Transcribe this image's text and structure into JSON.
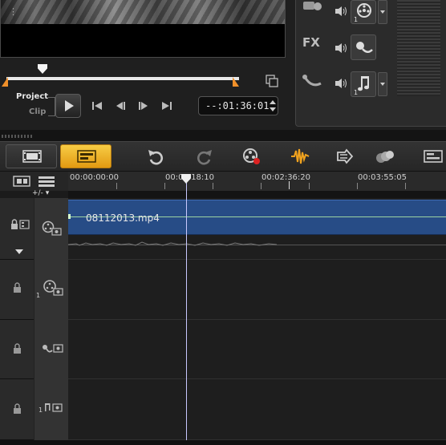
{
  "preview": {
    "timecode": "--:01:36:01"
  },
  "modes": {
    "project": "Project",
    "clip": "Clip"
  },
  "track_tools": {
    "fx_label": "FX",
    "track_numbers": [
      "1",
      "1"
    ]
  },
  "ruler": {
    "labels": [
      "00:00:00:00",
      "00:01:18:10",
      "00:02:36:20",
      "00:03:55:05"
    ],
    "add_remove": "+/-"
  },
  "timeline": {
    "clip_name": "08112013.mp4",
    "overlay_track_number": "1"
  },
  "colors": {
    "accent": "#f0a21e",
    "clip": "#274c86",
    "trim": "#f0902a"
  },
  "icons": {
    "toolbar": [
      "storyboard-view-icon",
      "timeline-view-icon",
      "undo-icon",
      "redo-icon",
      "record-capture-icon",
      "sound-mixer-icon",
      "auto-music-icon",
      "motion-tracking-icon",
      "subtitle-editor-icon"
    ]
  }
}
